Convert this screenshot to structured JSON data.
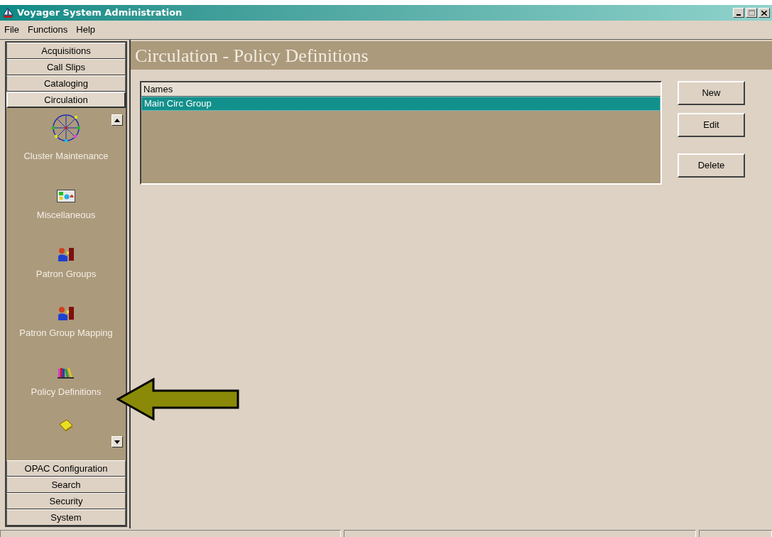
{
  "window": {
    "title": "Voyager System Administration"
  },
  "menu": [
    "File",
    "Functions",
    "Help"
  ],
  "sidebar": {
    "categories": [
      {
        "label": "Acquisitions",
        "selected": false
      },
      {
        "label": "Call Slips",
        "selected": false
      },
      {
        "label": "Cataloging",
        "selected": false
      },
      {
        "label": "Circulation",
        "selected": true,
        "items": [
          {
            "label": "Cluster Maintenance"
          },
          {
            "label": "Miscellaneous"
          },
          {
            "label": "Patron Groups"
          },
          {
            "label": "Patron Group Mapping"
          },
          {
            "label": "Policy Definitions"
          }
        ]
      },
      {
        "label": "OPAC Configuration",
        "selected": false
      },
      {
        "label": "Search",
        "selected": false
      },
      {
        "label": "Security",
        "selected": false
      },
      {
        "label": "System",
        "selected": false
      }
    ]
  },
  "main": {
    "title": "Circulation - Policy Definitions",
    "list": {
      "column": "Names",
      "rows": [
        {
          "label": "Main Circ Group",
          "selected": true
        }
      ]
    },
    "buttons": [
      "New",
      "Edit",
      "Delete"
    ]
  }
}
